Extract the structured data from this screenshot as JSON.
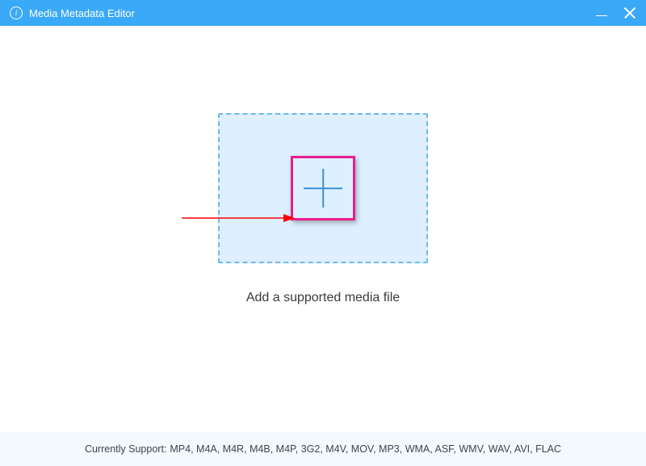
{
  "titlebar": {
    "icon_letter": "i",
    "title": "Media Metadata Editor"
  },
  "main": {
    "instruction": "Add a supported media file"
  },
  "footer": {
    "label": "Currently Support:",
    "formats": "MP4, M4A, M4R, M4B, M4P, 3G2, M4V, MOV, MP3, WMA, ASF, WMV, WAV, AVI, FLAC"
  }
}
